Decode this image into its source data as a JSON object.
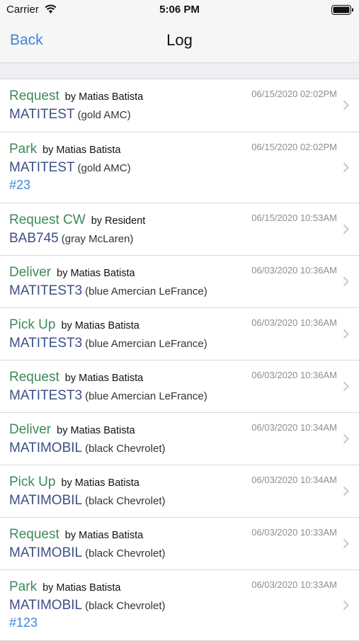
{
  "status_bar": {
    "carrier": "Carrier",
    "time": "5:06 PM"
  },
  "nav": {
    "back_label": "Back",
    "title": "Log"
  },
  "log": [
    {
      "action": "Request",
      "by": "by Matias Batista",
      "timestamp": "06/15/2020 02:02PM",
      "plate": "MATITEST",
      "vehicle": "(gold AMC)",
      "spot": ""
    },
    {
      "action": "Park",
      "by": "by Matias Batista",
      "timestamp": "06/15/2020 02:02PM",
      "plate": "MATITEST",
      "vehicle": "(gold AMC)",
      "spot": "#23"
    },
    {
      "action": "Request CW",
      "by": "by Resident",
      "timestamp": "06/15/2020 10:53AM",
      "plate": "BAB745",
      "vehicle": "(gray McLaren)",
      "spot": ""
    },
    {
      "action": "Deliver",
      "by": "by Matias Batista",
      "timestamp": "06/03/2020 10:36AM",
      "plate": "MATITEST3",
      "vehicle": "(blue Amercian LeFrance)",
      "spot": ""
    },
    {
      "action": "Pick Up",
      "by": "by Matias Batista",
      "timestamp": "06/03/2020 10:36AM",
      "plate": "MATITEST3",
      "vehicle": "(blue Amercian LeFrance)",
      "spot": ""
    },
    {
      "action": "Request",
      "by": "by Matias Batista",
      "timestamp": "06/03/2020 10:36AM",
      "plate": "MATITEST3",
      "vehicle": "(blue Amercian LeFrance)",
      "spot": ""
    },
    {
      "action": "Deliver",
      "by": "by Matias Batista",
      "timestamp": "06/03/2020 10:34AM",
      "plate": "MATIMOBIL",
      "vehicle": "(black Chevrolet)",
      "spot": ""
    },
    {
      "action": "Pick Up",
      "by": "by Matias Batista",
      "timestamp": "06/03/2020 10:34AM",
      "plate": "MATIMOBIL",
      "vehicle": "(black Chevrolet)",
      "spot": ""
    },
    {
      "action": "Request",
      "by": "by Matias Batista",
      "timestamp": "06/03/2020 10:33AM",
      "plate": "MATIMOBIL",
      "vehicle": "(black Chevrolet)",
      "spot": ""
    },
    {
      "action": "Park",
      "by": "by Matias Batista",
      "timestamp": "06/03/2020 10:33AM",
      "plate": "MATIMOBIL",
      "vehicle": "(black Chevrolet)",
      "spot": "#123"
    }
  ]
}
